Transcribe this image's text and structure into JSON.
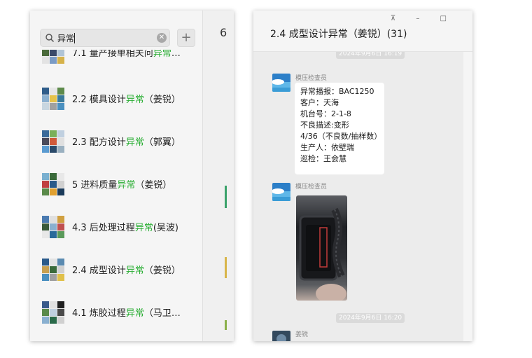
{
  "search": {
    "query": "异常",
    "clear_glyph": "✕",
    "add_glyph": "+",
    "results": [
      {
        "pre": "7.1 量产接单相关问",
        "hl": "异常",
        "post": "…"
      },
      {
        "pre": "2.2 模具设计",
        "hl": "异常",
        "post": "（姜锐）"
      },
      {
        "pre": "2.3 配方设计",
        "hl": "异常",
        "post": "（郭翼）"
      },
      {
        "pre": "5 进料质量",
        "hl": "异常",
        "post": "（姜锐）"
      },
      {
        "pre": "4.3 后处理过程",
        "hl": "异常",
        "post": "(吴波)"
      },
      {
        "pre": "2.4 成型设计",
        "hl": "异常",
        "post": "（姜锐）"
      },
      {
        "pre": "4.1 炼胶过程",
        "hl": "异常",
        "post": "（马卫…"
      }
    ],
    "highlight_color": "#2aae34"
  },
  "peek": {
    "char": "6"
  },
  "chat": {
    "window_controls": "⊼ – □",
    "title": "2.4 成型设计异常（姜锐）(31)",
    "timestamp_top": "2024年9月6日 16:19",
    "messages": [
      {
        "sender": "模压检查员",
        "lines": [
          "异常播报：BAC1250",
          "客户：天海",
          "机台号：2-1-8",
          "不良描述:变形",
          "4/36（不良数/抽样数）",
          "生产人：依壁瑞",
          "巡检：王会慧"
        ]
      },
      {
        "sender": "模压检查员",
        "type": "image"
      }
    ],
    "timestamp_bottom": "2024年9月6日 16:20",
    "last_sender": "姜锐"
  }
}
